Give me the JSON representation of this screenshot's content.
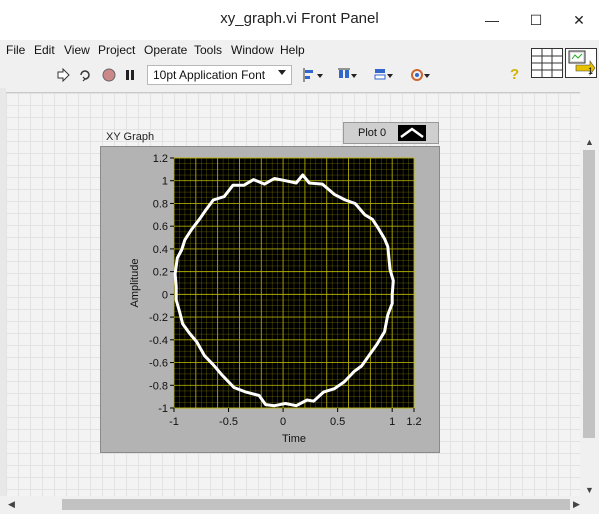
{
  "window": {
    "title": "xy_graph.vi Front Panel",
    "minimize_glyph": "—",
    "maximize_glyph": "☐",
    "close_glyph": "✕"
  },
  "menu": [
    "File",
    "Edit",
    "View",
    "Project",
    "Operate",
    "Tools",
    "Window",
    "Help"
  ],
  "toolbar": {
    "icons": [
      "run-arrow-icon",
      "run-continuously-icon",
      "abort-icon",
      "pause-icon"
    ],
    "font_select": "10pt Application Font",
    "tool_icons": [
      "align-objects-icon",
      "distribute-objects-icon",
      "resize-objects-icon",
      "reorder-icon"
    ],
    "help_glyph": "?"
  },
  "vi_icon": {
    "number": "1"
  },
  "graph": {
    "label": "XY Graph",
    "legend_label": "Plot 0",
    "plot_color": "#ffffff",
    "plot_bg": "#000000",
    "grid_color": "#b8b400"
  },
  "chart_data": {
    "type": "line",
    "title": "",
    "xlabel": "Time",
    "ylabel": "Amplitude",
    "xlim": [
      -1,
      1.2
    ],
    "ylim": [
      -1,
      1.2
    ],
    "x_ticks": [
      -1,
      -0.5,
      0,
      0.5,
      1,
      1.2
    ],
    "y_ticks": [
      1.2,
      1,
      0.8,
      0.6,
      0.4,
      0.2,
      0,
      -0.2,
      -0.4,
      -0.6,
      -0.8,
      -1
    ],
    "series": [
      {
        "name": "Plot 0",
        "x": [
          1.0,
          1.01,
          0.98,
          0.97,
          0.96,
          0.93,
          0.88,
          0.82,
          0.75,
          0.66,
          0.57,
          0.47,
          0.36,
          0.24,
          0.18,
          0.12,
          0.02,
          -0.08,
          -0.17,
          -0.27,
          -0.36,
          -0.46,
          -0.54,
          -0.64,
          -0.71,
          -0.76,
          -0.84,
          -0.9,
          -0.93,
          -0.97,
          -0.99,
          -0.98,
          -0.98,
          -0.95,
          -0.92,
          -0.86,
          -0.79,
          -0.72,
          -0.64,
          -0.56,
          -0.45,
          -0.34,
          -0.22,
          -0.16,
          -0.08,
          0.02,
          0.12,
          0.22,
          0.28,
          0.37,
          0.47,
          0.56,
          0.65,
          0.72,
          0.8,
          0.86,
          0.93,
          0.96,
          1.0
        ],
        "y": [
          0.0,
          0.12,
          0.22,
          0.32,
          0.42,
          0.49,
          0.57,
          0.66,
          0.7,
          0.8,
          0.83,
          0.88,
          0.97,
          0.98,
          1.05,
          0.98,
          1.0,
          1.02,
          0.97,
          1.01,
          0.96,
          0.96,
          0.86,
          0.83,
          0.74,
          0.67,
          0.57,
          0.48,
          0.39,
          0.32,
          0.18,
          0.07,
          -0.05,
          -0.15,
          -0.26,
          -0.34,
          -0.42,
          -0.54,
          -0.62,
          -0.71,
          -0.82,
          -0.86,
          -0.89,
          -0.97,
          -0.98,
          -0.96,
          -0.98,
          -0.93,
          -0.94,
          -0.86,
          -0.83,
          -0.77,
          -0.68,
          -0.63,
          -0.52,
          -0.44,
          -0.33,
          -0.18,
          -0.08
        ]
      }
    ],
    "grid": true,
    "legend_position": "top-right"
  }
}
